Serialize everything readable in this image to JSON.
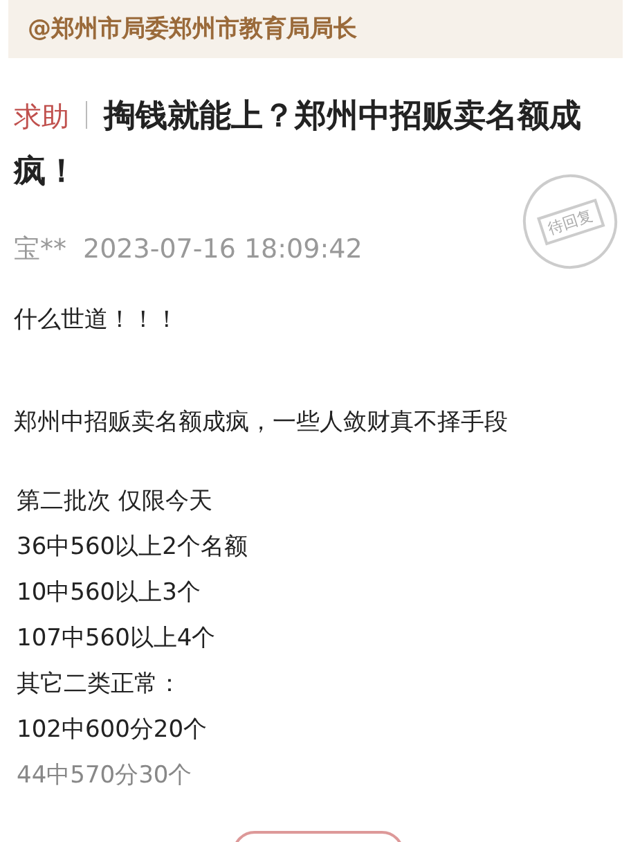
{
  "mention": "@郑州市局委郑州市教育局局长",
  "post": {
    "tag": "求助",
    "title": "掏钱就能上？郑州中招贩卖名额成疯！",
    "author": "宝**",
    "time": "2023-07-16 18:09:42",
    "stamp": "待回复"
  },
  "body": [
    "什么世道！！！",
    "郑州中招贩卖名额成疯，一些人敛财真不择手段"
  ],
  "list": [
    "第二批次 仅限今天",
    "36中560以上2个名额",
    "10中560以上3个",
    "107中560以上4个",
    "其它二类正常：",
    "102中600分20个",
    "44中570分30个"
  ]
}
